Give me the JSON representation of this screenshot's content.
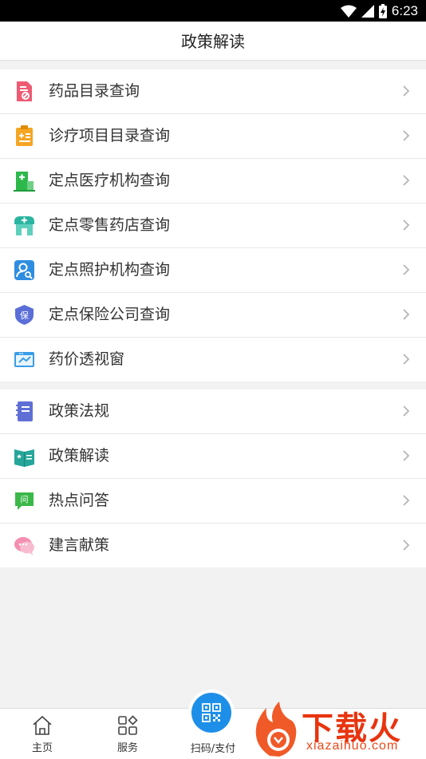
{
  "status_bar": {
    "time": "6:23"
  },
  "header": {
    "title": "政策解读"
  },
  "group1": [
    {
      "label": "药品目录查询",
      "icon": "drug-catalog-icon"
    },
    {
      "label": "诊疗项目目录查询",
      "icon": "treatment-items-icon"
    },
    {
      "label": "定点医疗机构查询",
      "icon": "hospital-icon"
    },
    {
      "label": "定点零售药店查询",
      "icon": "pharmacy-icon"
    },
    {
      "label": "定点照护机构查询",
      "icon": "care-facility-icon"
    },
    {
      "label": "定点保险公司查询",
      "icon": "insurance-shield-icon"
    },
    {
      "label": "药价透视窗",
      "icon": "price-window-icon"
    }
  ],
  "group2": [
    {
      "label": "政策法规",
      "icon": "policy-book-icon"
    },
    {
      "label": "政策解读",
      "icon": "policy-reading-icon"
    },
    {
      "label": "热点问答",
      "icon": "qa-chat-icon"
    },
    {
      "label": "建言献策",
      "icon": "suggestion-chat-icon"
    }
  ],
  "tabbar": {
    "home": "主页",
    "services": "服务",
    "scan": "扫码/支付"
  },
  "watermark": {
    "brand": "下载火",
    "url": "xiazaihuo.com"
  }
}
